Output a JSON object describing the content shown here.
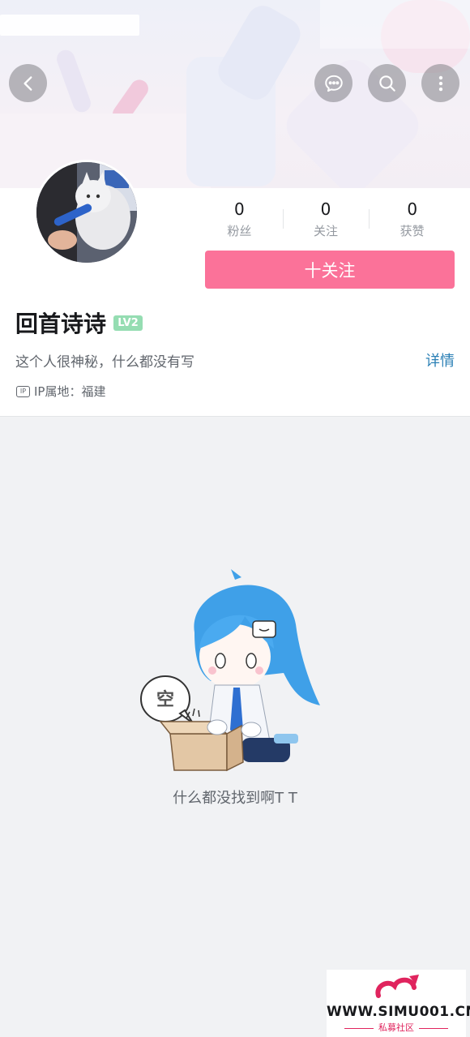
{
  "header": {
    "back_icon": "chevron-left-icon",
    "message_icon": "chat-bubble-icon",
    "search_icon": "search-icon",
    "more_icon": "more-vertical-icon"
  },
  "profile": {
    "stats": [
      {
        "value": "0",
        "label": "粉丝"
      },
      {
        "value": "0",
        "label": "关注"
      },
      {
        "value": "0",
        "label": "获赞"
      }
    ],
    "follow_label": "十关注",
    "username": "回首诗诗",
    "level": "LV2",
    "bio": "这个人很神秘，什么都没有写",
    "detail_label": "详情",
    "ip_badge": "IP",
    "ip_location": "IP属地：福建"
  },
  "empty_state": {
    "bubble_text": "空",
    "message": "什么都没找到啊T T"
  },
  "watermark": {
    "url": "WWW.SIMU001.CN",
    "sub": "私募社区"
  },
  "colors": {
    "accent_pink": "#fb7299",
    "link_blue": "#2a7fb5",
    "level_green": "#95ddb2",
    "background": "#f1f2f4"
  }
}
